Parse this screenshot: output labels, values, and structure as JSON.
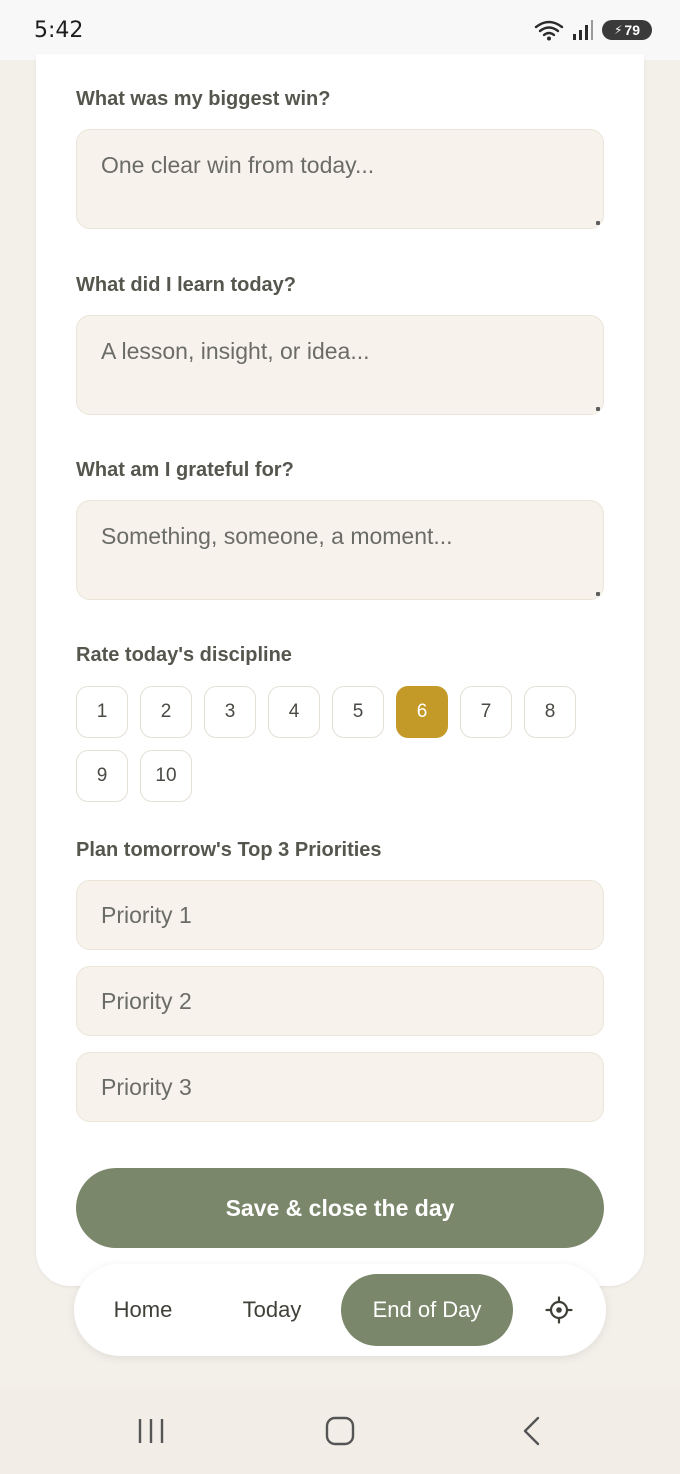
{
  "status": {
    "time": "5:42",
    "battery": "79",
    "wifi_icon": "wifi-icon",
    "signal_icon": "signal-icon"
  },
  "form": {
    "questions": [
      {
        "label": "What was my biggest win?",
        "placeholder": "One clear win from today..."
      },
      {
        "label": "What did I learn today?",
        "placeholder": "A lesson, insight, or idea..."
      },
      {
        "label": "What am I grateful for?",
        "placeholder": "Something, someone, a moment..."
      }
    ],
    "rating": {
      "label": "Rate today's discipline",
      "options": [
        "1",
        "2",
        "3",
        "4",
        "5",
        "6",
        "7",
        "8",
        "9",
        "10"
      ],
      "selected": "6",
      "selected_color": "#c39a27"
    },
    "priorities": {
      "label": "Plan tomorrow's Top 3 Priorities",
      "placeholders": [
        "Priority 1",
        "Priority 2",
        "Priority 3"
      ]
    },
    "save_label": "Save & close the day",
    "accent_color": "#7a876a"
  },
  "nav": {
    "items": [
      "Home",
      "Today",
      "End of Day"
    ],
    "active": "End of Day",
    "settings_icon": "gear-icon"
  },
  "system_nav": {
    "recents_icon": "recents-icon",
    "home_icon": "home-icon",
    "back_icon": "back-icon"
  }
}
